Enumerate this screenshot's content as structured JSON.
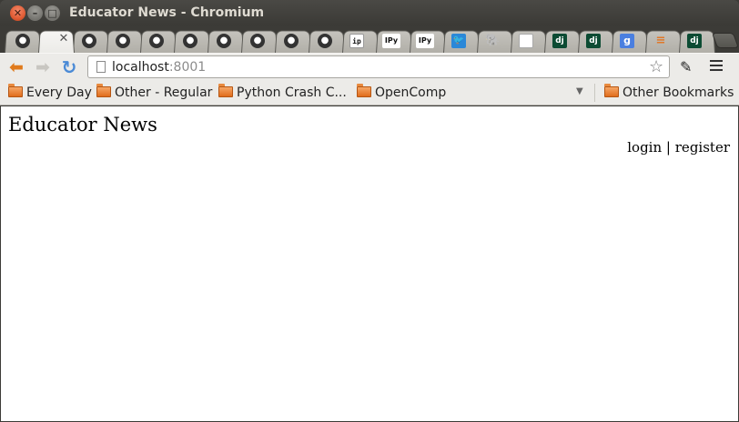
{
  "window": {
    "title": "Educator News - Chromium"
  },
  "tabs": [
    {
      "icon": "github-icon"
    },
    {
      "icon": "close-icon",
      "active": true
    },
    {
      "icon": "github-icon"
    },
    {
      "icon": "github-icon"
    },
    {
      "icon": "github-icon"
    },
    {
      "icon": "github-icon"
    },
    {
      "icon": "github-icon"
    },
    {
      "icon": "github-icon"
    },
    {
      "icon": "github-icon"
    },
    {
      "icon": "github-icon"
    },
    {
      "icon": "ip-icon",
      "text": "ip"
    },
    {
      "icon": "ipython-icon",
      "text": "IPy"
    },
    {
      "icon": "ipython-icon",
      "text": "IPy"
    },
    {
      "icon": "twitter-icon"
    },
    {
      "icon": "postgresql-icon"
    },
    {
      "icon": "document-icon"
    },
    {
      "icon": "django-icon",
      "text": "dj"
    },
    {
      "icon": "django-icon",
      "text": "dj"
    },
    {
      "icon": "google-icon",
      "text": "g"
    },
    {
      "icon": "stackoverflow-icon"
    },
    {
      "icon": "django-icon",
      "text": "dj"
    }
  ],
  "toolbar": {
    "url_host": "localhost",
    "url_port": ":8001"
  },
  "bookmarks": [
    {
      "label": "Every Day"
    },
    {
      "label": "Other - Regular"
    },
    {
      "label": "Python Crash C..."
    },
    {
      "label": "OpenComp"
    }
  ],
  "other_bookmarks": "Other Bookmarks",
  "page": {
    "site_title": "Educator News",
    "login": "login",
    "separator": "|",
    "register": "register"
  },
  "colors": {
    "back_arrow": "#e07a1c",
    "reload": "#4a8ad6",
    "close_button": "#e05c34",
    "folder": "#e06c1b"
  }
}
